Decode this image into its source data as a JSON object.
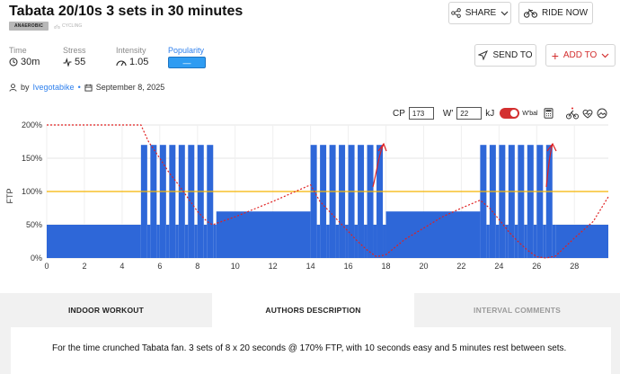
{
  "header": {
    "title": "Tabata 20/10s 3 sets in 30 minutes",
    "tag": "ANAEROBIC",
    "category": "CYCLING",
    "share_label": "SHARE",
    "ride_label": "RIDE NOW",
    "send_label": "SEND TO",
    "add_label": "ADD TO"
  },
  "stats": {
    "time_label": "Time",
    "time_value": "30m",
    "stress_label": "Stress",
    "stress_value": "55",
    "intensity_label": "Intensity",
    "intensity_value": "1.05",
    "popularity_label": "Popularity",
    "popularity_value": "—"
  },
  "author": {
    "by": "by",
    "name": "Ivegotabike",
    "sep": "•",
    "date": "September 8, 2025"
  },
  "controls": {
    "cp_label": "CP",
    "cp_value": "173",
    "w_label": "W'",
    "w_value": "22",
    "w_unit": "kJ",
    "wbal_label": "W'bal",
    "wbal_on": true
  },
  "chart_data": {
    "type": "bar",
    "ylabel": "FTP",
    "x_ticks": [
      0,
      2,
      4,
      6,
      8,
      10,
      12,
      14,
      16,
      18,
      20,
      22,
      24,
      26,
      28
    ],
    "y_ticks": [
      "0%",
      "50%",
      "100%",
      "150%",
      "200%"
    ],
    "xlim": [
      0,
      29.8
    ],
    "ylim": [
      0,
      200
    ],
    "ftp_line": 100,
    "ftp_line_color": "#f5b400",
    "bar_color": "#2e67d8",
    "wbal_color": "#e02020",
    "blocks": [
      {
        "start": 0,
        "end": 5,
        "power": 50
      },
      {
        "set": 1,
        "start": 5,
        "reps": 8,
        "on": 0.3333,
        "off": 0.1667,
        "on_power": 170,
        "off_power": 50
      },
      {
        "start": 9,
        "end": 14,
        "power": 70
      },
      {
        "set": 2,
        "start": 14,
        "reps": 8,
        "on": 0.3333,
        "off": 0.1667,
        "on_power": 170,
        "off_power": 50
      },
      {
        "start": 18,
        "end": 23,
        "power": 70
      },
      {
        "set": 3,
        "start": 23,
        "reps": 8,
        "on": 0.3333,
        "off": 0.1667,
        "on_power": 170,
        "off_power": 50
      },
      {
        "start": 27,
        "end": 30,
        "power": 50
      }
    ],
    "wbal": [
      [
        0,
        200
      ],
      [
        5,
        200
      ],
      [
        5.4,
        175
      ],
      [
        6,
        150
      ],
      [
        6.5,
        128
      ],
      [
        7,
        110
      ],
      [
        7.5,
        90
      ],
      [
        8,
        70
      ],
      [
        8.5,
        55
      ],
      [
        8.8,
        50
      ],
      [
        10,
        62
      ],
      [
        12,
        85
      ],
      [
        14,
        110
      ],
      [
        14.5,
        85
      ],
      [
        15,
        70
      ],
      [
        15.5,
        55
      ],
      [
        16,
        40
      ],
      [
        16.5,
        25
      ],
      [
        17,
        12
      ],
      [
        17.5,
        2
      ],
      [
        18,
        5
      ],
      [
        19,
        28
      ],
      [
        20,
        45
      ],
      [
        21,
        62
      ],
      [
        22,
        75
      ],
      [
        23,
        87
      ],
      [
        23.5,
        75
      ],
      [
        24,
        58
      ],
      [
        24.5,
        40
      ],
      [
        25,
        25
      ],
      [
        25.5,
        12
      ],
      [
        26,
        2
      ],
      [
        26.5,
        0
      ],
      [
        27,
        3
      ],
      [
        28,
        30
      ],
      [
        29,
        55
      ],
      [
        29.8,
        92
      ]
    ]
  },
  "tabs": {
    "indoor": "INDOOR WORKOUT",
    "authors": "AUTHORS DESCRIPTION",
    "interval": "INTERVAL COMMENTS"
  },
  "description": "For the time crunched Tabata fan. 3 sets of 8 x 20 seconds @ 170% FTP, with 10 seconds easy and 5 minutes rest between sets."
}
